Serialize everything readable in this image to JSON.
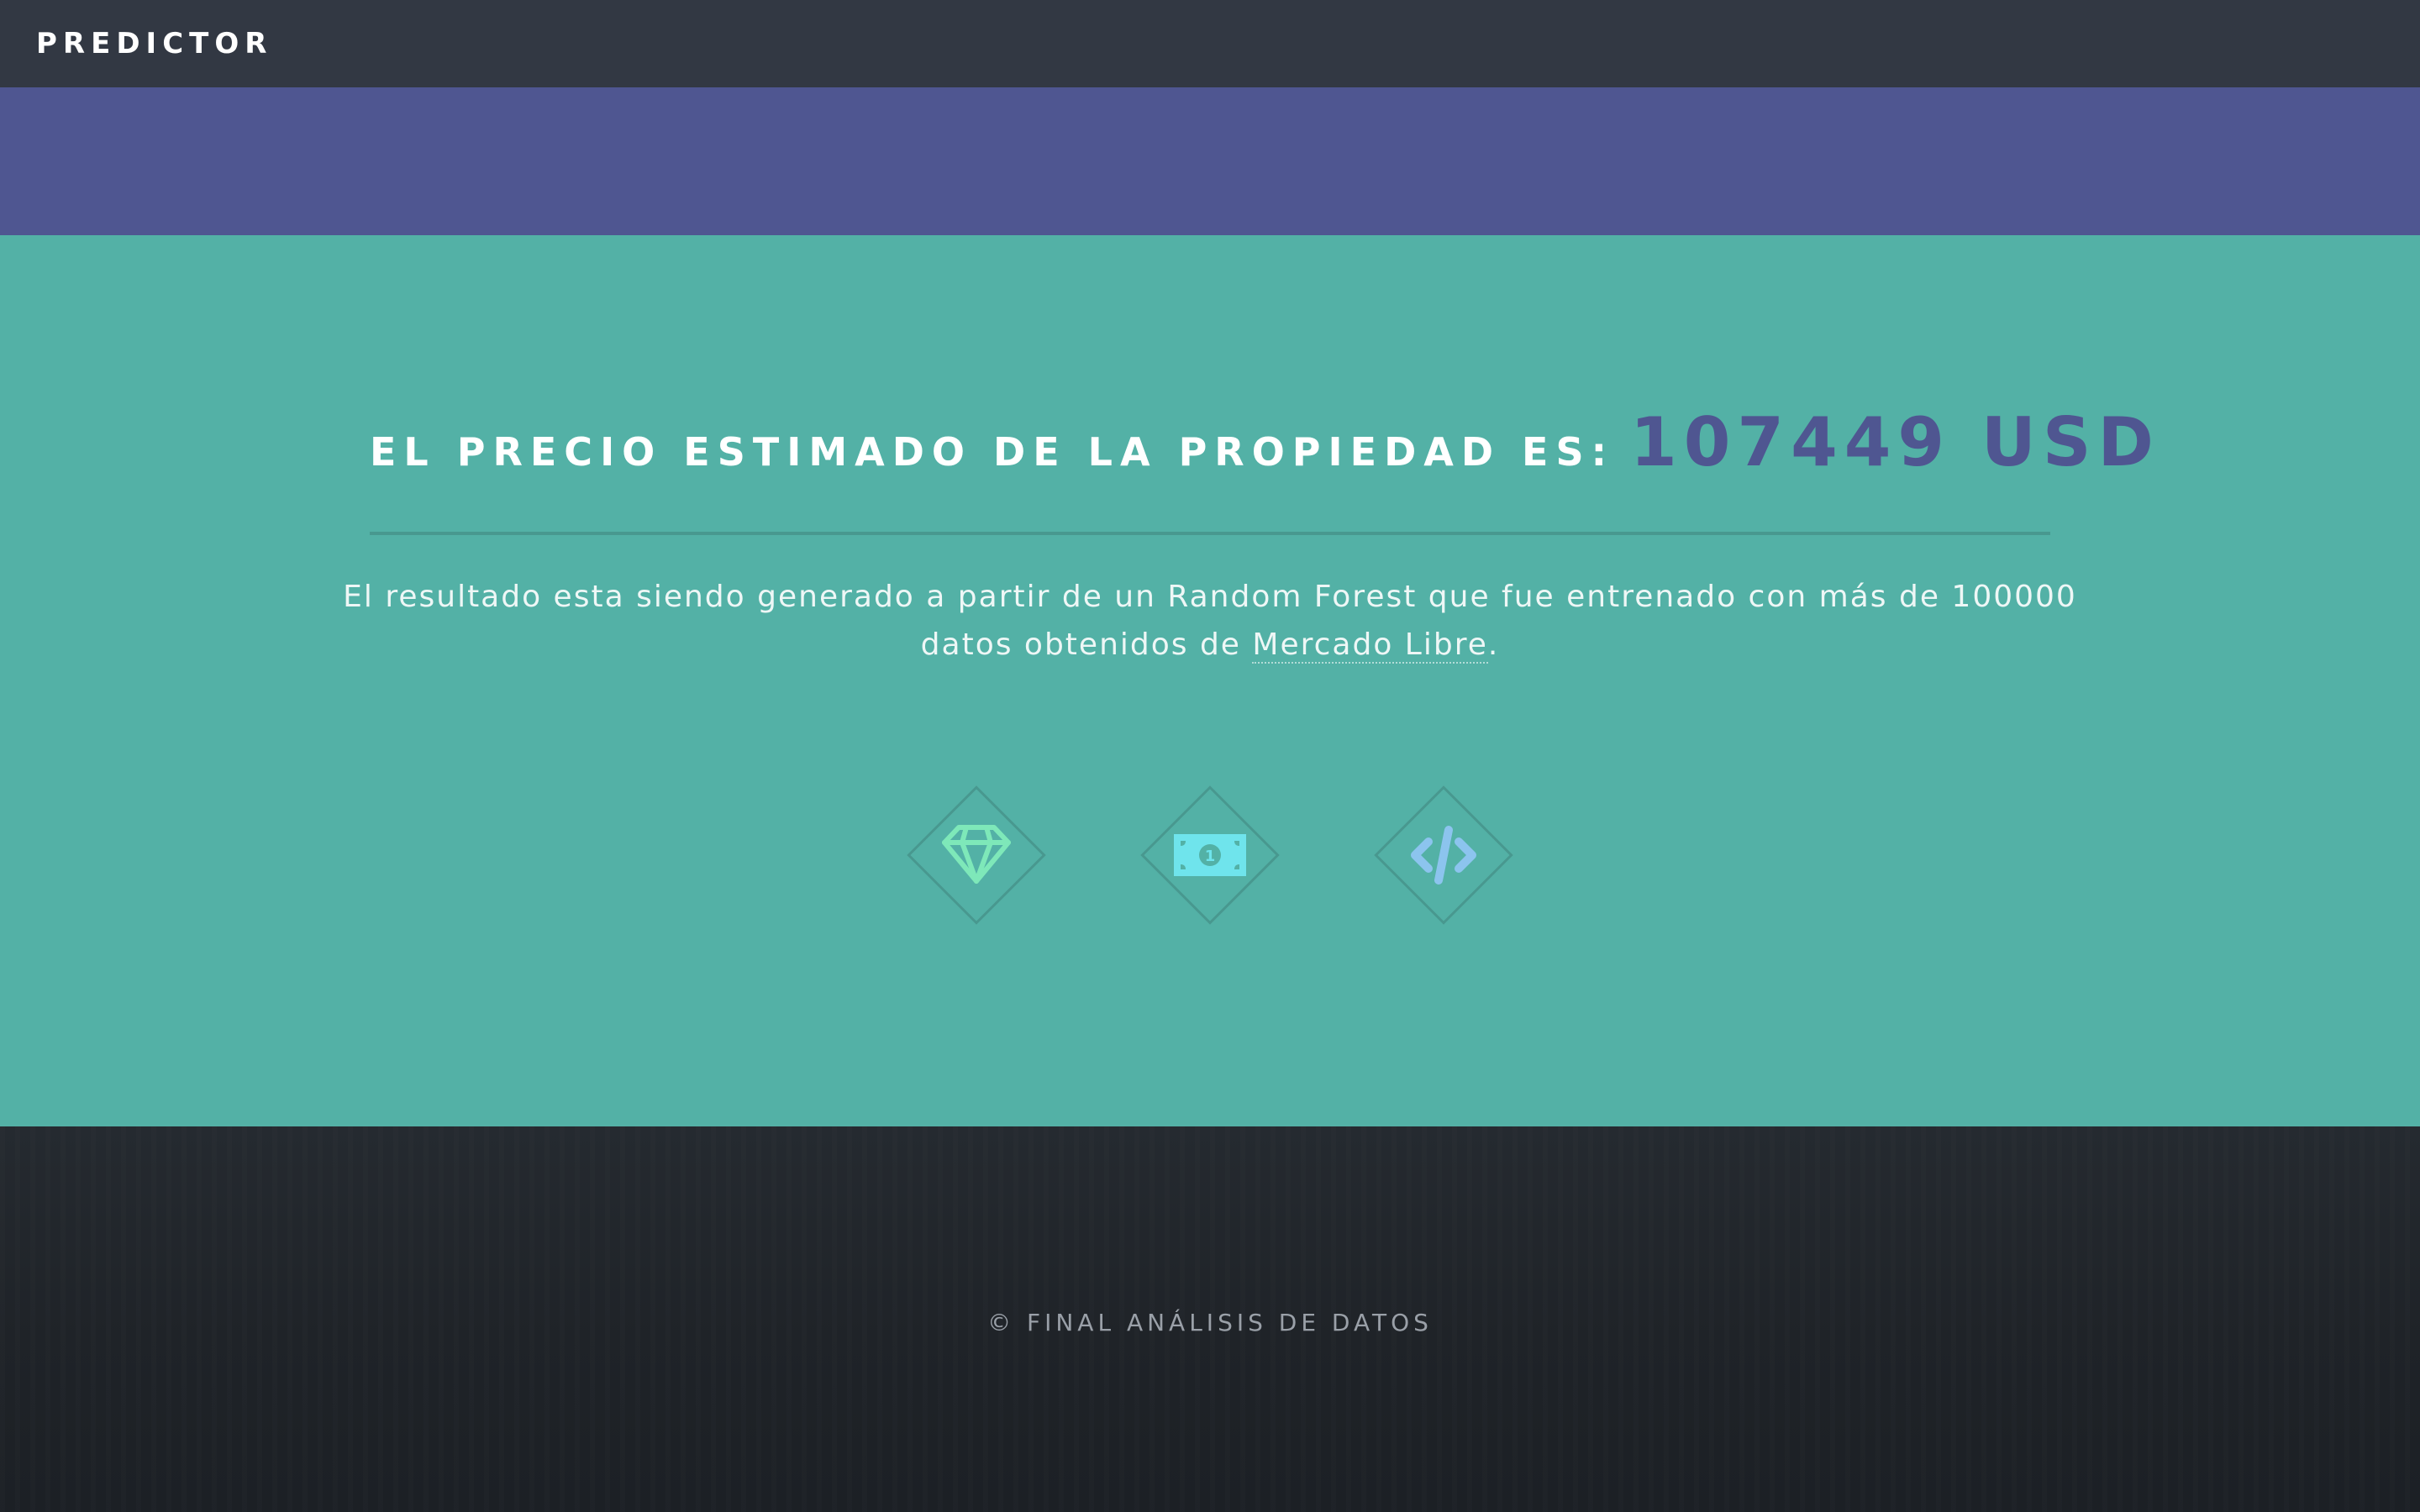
{
  "header": {
    "brand": "PREDICTOR"
  },
  "result": {
    "label": "EL PRECIO ESTIMADO DE LA PROPIEDAD ES:",
    "price": "107449 USD",
    "description_before": "El resultado esta siendo generado a partir de un Random Forest que fue entrenado con más de 100000 datos obtenidos de ",
    "link_text": "Mercado Libre",
    "description_after": "."
  },
  "icons": [
    {
      "name": "diamond-icon",
      "color": "#7ee8b9"
    },
    {
      "name": "money-bill-icon",
      "color": "#6fe4ec"
    },
    {
      "name": "code-icon",
      "color": "#8cc4ee"
    }
  ],
  "colors": {
    "topbar": "#323843",
    "banner": "#4f5691",
    "wrapper": "#53b1a6",
    "price": "#4f5691",
    "footer": "#1e2227"
  },
  "footer": {
    "copyright": "© FINAL ANÁLISIS DE DATOS"
  }
}
